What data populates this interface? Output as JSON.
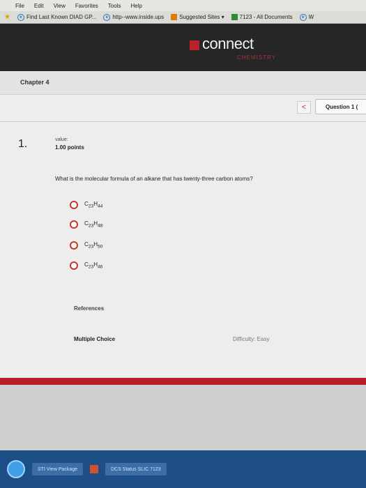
{
  "browser": {
    "menu": [
      "File",
      "Edit",
      "View",
      "Favorites",
      "Tools",
      "Help"
    ],
    "favorites": [
      {
        "label": "Find Last Known DIAD GP...",
        "icon": "ie-icon"
      },
      {
        "label": "http--www.inside.ups",
        "icon": "ie-icon"
      },
      {
        "label": "Suggested Sites ▾",
        "icon": "orange-square-icon"
      },
      {
        "label": "7123 - All Documents",
        "icon": "green-square-icon"
      },
      {
        "label": "W",
        "icon": "ie-icon"
      }
    ]
  },
  "header": {
    "logo": "connect",
    "subtitle": "CHEMISTRY"
  },
  "page": {
    "chapter": "Chapter 4",
    "prev_glyph": "<",
    "question_selector": "Question 1 (",
    "question_number": "1.",
    "value_label": "value:",
    "points": "1.00 points",
    "question_text": "What is the molecular formula of an alkane that has twenty-three carbon atoms?",
    "options": [
      {
        "base": "C",
        "sub1": "23",
        "mid": "H",
        "sub2": "44"
      },
      {
        "base": "C",
        "sub1": "23",
        "mid": "H",
        "sub2": "48"
      },
      {
        "base": "C",
        "sub1": "23",
        "mid": "H",
        "sub2": "50"
      },
      {
        "base": "C",
        "sub1": "23",
        "mid": "H",
        "sub2": "46"
      }
    ],
    "references": "References",
    "question_type": "Multiple Choice",
    "difficulty": "Difficulty: Easy"
  },
  "taskbar": {
    "items": [
      "STI View Package",
      "DCS Status SLIC 7123"
    ]
  },
  "colors": {
    "accent_red": "#b71f28",
    "header_bg": "#262626",
    "taskbar_bg": "#1d4f86"
  }
}
